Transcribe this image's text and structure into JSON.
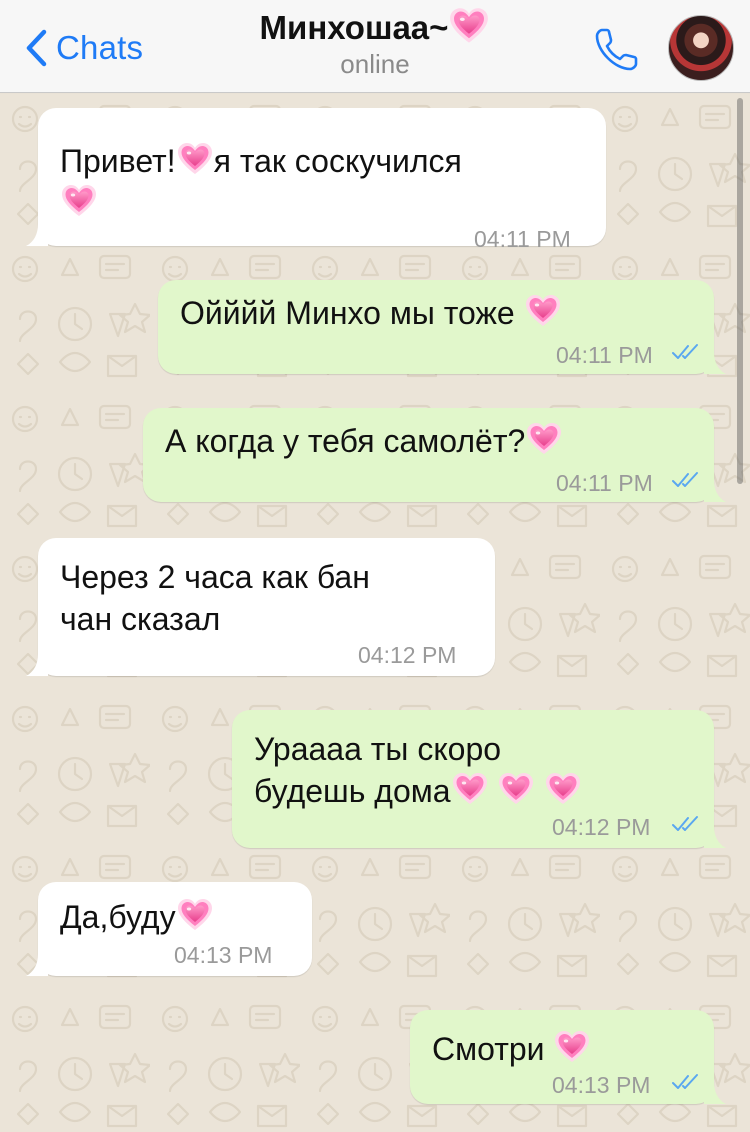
{
  "header": {
    "back_label": "Chats",
    "title": "Минхошаа~",
    "status": "online"
  },
  "messages": [
    {
      "direction": "in",
      "lines": [
        "Привет!",
        "я так соскучился"
      ],
      "time": "04:11 PM"
    },
    {
      "direction": "out",
      "lines": [
        "Ойййй Минхо мы тоже"
      ],
      "time": "04:11 PM",
      "ticks": "read"
    },
    {
      "direction": "out",
      "lines": [
        "А когда у тебя самолёт?"
      ],
      "time": "04:11 PM",
      "ticks": "read"
    },
    {
      "direction": "in",
      "lines": [
        "Через 2 часа как бан",
        "чан сказал"
      ],
      "time": "04:12 PM"
    },
    {
      "direction": "out",
      "lines": [
        "Ураааа ты скоро",
        "будешь дома"
      ],
      "time": "04:12 PM",
      "ticks": "read"
    },
    {
      "direction": "in",
      "lines": [
        "Да,буду"
      ],
      "time": "04:13 PM"
    },
    {
      "direction": "out",
      "lines": [
        "Смотри"
      ],
      "time": "04:13 PM",
      "ticks": "read"
    }
  ],
  "icons": {
    "back": "chevron-left-icon",
    "call": "phone-icon",
    "emoji": "growing-heart-emoji",
    "read_receipt": "double-check-icon"
  },
  "colors": {
    "accent": "#1f7bf6",
    "incoming_bubble": "#ffffff",
    "outgoing_bubble": "#e1f7cb",
    "ticks": "#5aa7f0"
  }
}
